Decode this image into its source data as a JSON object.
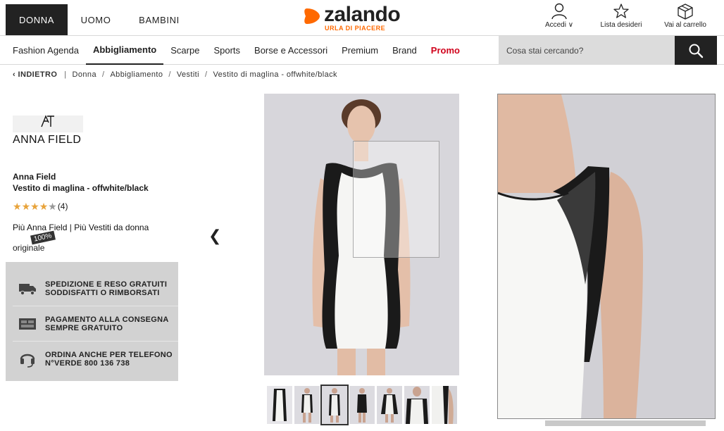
{
  "header": {
    "gender_tabs": [
      "DONNA",
      "UOMO",
      "BAMBINI"
    ],
    "logo": {
      "word": "zalando",
      "tagline": "URLA DI PIACERE"
    },
    "actions": [
      {
        "label": "Accedi ∨",
        "icon": "user-icon"
      },
      {
        "label": "Lista desideri",
        "icon": "star-icon"
      },
      {
        "label": "Vai al carrello",
        "icon": "box-icon"
      }
    ]
  },
  "nav": {
    "items": [
      "Fashion Agenda",
      "Abbigliamento",
      "Scarpe",
      "Sports",
      "Borse e Accessori",
      "Premium",
      "Brand",
      "Promo"
    ],
    "active": "Abbigliamento",
    "search_placeholder": "Cosa stai cercando?"
  },
  "breadcrumb": {
    "back": "‹ INDIETRO",
    "items": [
      "Donna",
      "Abbigliamento",
      "Vestiti",
      "Vestito di maglina - offwhite/black"
    ]
  },
  "product": {
    "brand_logo_text": "ANNA FIELD",
    "brand": "Anna Field",
    "name": "Vestito di maglina - offwhite/black",
    "rating_stars": 4,
    "rating_max": 5,
    "rating_count": "(4)",
    "more_brand": "Più Anna Field",
    "more_category": "Più Vestiti da donna",
    "badge": "100%",
    "badge_caption": "originale"
  },
  "services": [
    {
      "line1": "SPEDIZIONE E RESO GRATUITI",
      "line2": "SODDISFATTI O RIMBORSATI",
      "icon": "truck-icon"
    },
    {
      "line1": "PAGAMENTO ALLA CONSEGNA",
      "line2": "SEMPRE GRATUITO",
      "icon": "payment-icon"
    },
    {
      "line1": "ORDINA ANCHE PER TELEFONO",
      "line2": "N°VERDE 800 136 738",
      "icon": "headset-icon"
    }
  ],
  "gallery": {
    "thumbnail_count": 7,
    "active_thumbnail": 3
  },
  "colors": {
    "dark": "#222222",
    "accent_orange": "#ff6900",
    "promo_red": "#d0011b",
    "star": "#e8a33a",
    "service_bg": "#d2d2d2"
  }
}
